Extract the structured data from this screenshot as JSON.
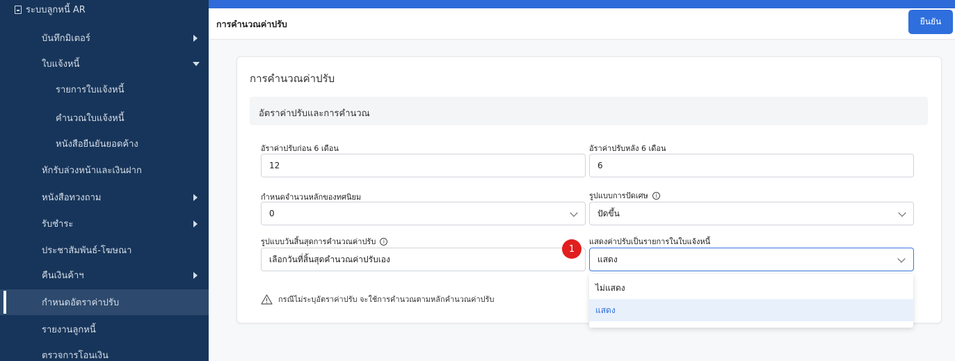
{
  "sidebar": {
    "top_label": "ระบบลูกหนี้ AR",
    "items": [
      {
        "label": "บันทึกมิเตอร์"
      },
      {
        "label": "ใบแจ้งหนี้"
      },
      {
        "label": "รายการใบแจ้งหนี้"
      },
      {
        "label": "คำนวณใบแจ้งหนี้"
      },
      {
        "label": "หนังสือยืนยันยอดค้าง"
      },
      {
        "label": "หักรับล่วงหน้าและเงินฝาก"
      },
      {
        "label": "หนังสือทวงถาม"
      },
      {
        "label": "รับชำระ"
      },
      {
        "label": "ประชาสัมพันธ์-โฆษณา"
      },
      {
        "label": "คืนเงินค้าฯ"
      },
      {
        "label": "กำหนดอัตราค่าปรับ"
      },
      {
        "label": "รายงานลูกหนี้"
      },
      {
        "label": "ตรวจการโอนเงิน"
      }
    ]
  },
  "header": {
    "title": "การคำนวณค่าปรับ",
    "confirm_label": "ยืนยัน"
  },
  "card": {
    "title": "การคำนวณค่าปรับ",
    "section_title": "อัตราค่าปรับและการคำนวณ",
    "fields": {
      "rate_before_label": "อัราค่าปรับก่อน 6 เดือน",
      "rate_before_value": "12",
      "rate_after_label": "อัราค่าปรับหลัง 6 เดือน",
      "rate_after_value": "6",
      "decimal_label": "กำหนดจำนวนหลักของทศนิยม",
      "decimal_value": "0",
      "rounding_label": "รูปแบบการปัดเศษ",
      "rounding_value": "ปัดขึ้น",
      "end_date_label": "รูปแบบวันสิ้นสุดการคำนวณค่าปรับ",
      "end_date_value": "เลือกวันที่สิ้นสุดคำนวณค่าปรับเอง",
      "show_penalty_label": "แสดงค่าปรับเป็นรายการในใบแจ้งหนี้",
      "show_penalty_value": "แสดง"
    },
    "warning": "กรณีไม่ระบุอัตราค่าปรับ จะใช้การคำนวณตามหลักคำนวณค่าปรับ"
  },
  "dropdown": {
    "options": [
      "ไม่แสดง",
      "แสดง"
    ],
    "selected": "แสดง"
  },
  "annotation": {
    "badge": "1"
  },
  "colors": {
    "sidebar_bg": "#17355a",
    "accent": "#2f6fdd",
    "badge": "#e11f1f"
  }
}
